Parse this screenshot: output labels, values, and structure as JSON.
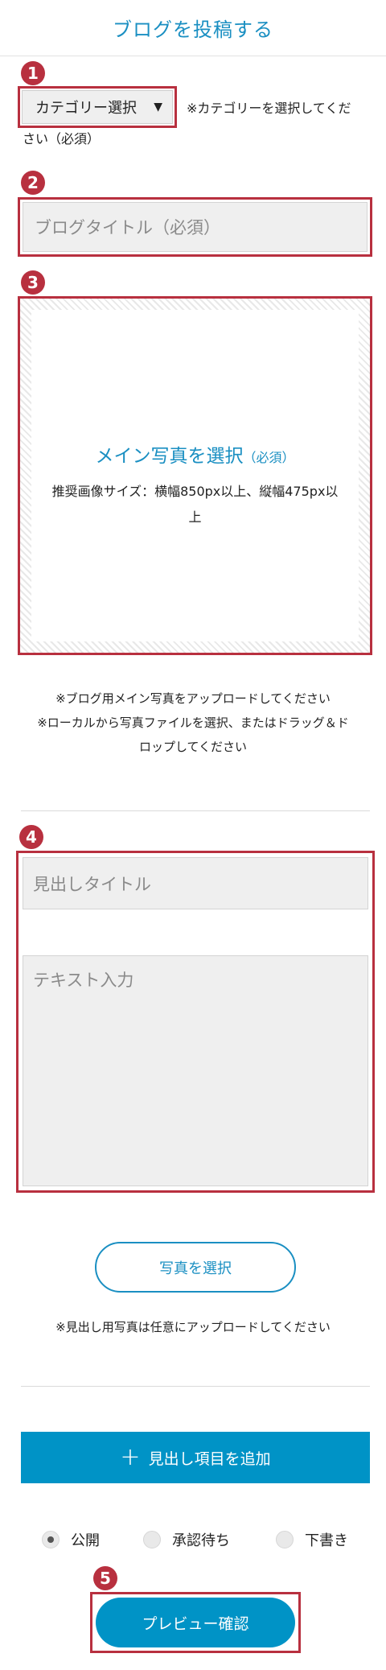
{
  "header": {
    "title": "ブログを投稿する"
  },
  "badges": [
    "1",
    "2",
    "3",
    "4",
    "5"
  ],
  "category": {
    "select_label": "カテゴリー選択",
    "arrow": "▼",
    "note_line1": "※カテゴリーを選択してくだ",
    "note_line2": "さい（必須）"
  },
  "blog_title": {
    "placeholder": "ブログタイトル（必須）"
  },
  "main_photo": {
    "title": "メイン写真を選択",
    "title_suffix": "（必須）",
    "spec_line1": "推奨画像サイズ：横幅850px以上、縦幅475px以",
    "spec_line2": "上",
    "note_line1": "※ブログ用メイン写真をアップロードしてください",
    "note_line2": "※ローカルから写真ファイルを選択、またはドラッグ＆ド",
    "note_line3": "ロップしてください"
  },
  "section": {
    "heading_placeholder": "見出しタイトル",
    "text_placeholder": "テキスト入力",
    "photo_button": "写真を選択",
    "photo_note": "※見出し用写真は任意にアップロードしてください"
  },
  "add_heading": {
    "plus": "+",
    "label": "見出し項目を追加"
  },
  "status": {
    "options": [
      "公開",
      "承認待ち",
      "下書き"
    ],
    "selected": "公開"
  },
  "preview_button": "プレビュー確認",
  "colors": {
    "accent": "#1a8fc2",
    "highlight": "#b8303f",
    "button": "#0093c6"
  }
}
